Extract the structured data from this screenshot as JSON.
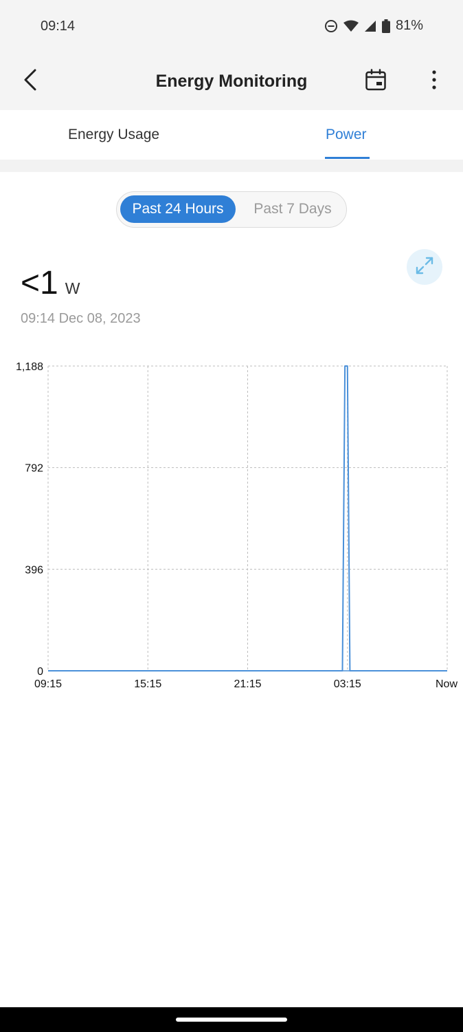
{
  "status_bar": {
    "time": "09:14",
    "battery": "81%"
  },
  "app_bar": {
    "title": "Energy Monitoring"
  },
  "tabs": [
    {
      "label": "Energy Usage",
      "active": false
    },
    {
      "label": "Power",
      "active": true
    }
  ],
  "range_selector": {
    "options": [
      "Past 24 Hours",
      "Past 7 Days"
    ],
    "selected": "Past 24 Hours"
  },
  "reading": {
    "value": "<1",
    "unit": "W",
    "timestamp": "09:14  Dec 08, 2023"
  },
  "colors": {
    "accent": "#2f7fd6",
    "line": "#4a90d9",
    "grid": "#bdbdbd"
  },
  "icons": [
    "back-arrow",
    "calendar",
    "more-vertical",
    "expand"
  ],
  "chart_data": {
    "type": "line",
    "x_ticks": [
      "09:15",
      "15:15",
      "21:15",
      "03:15",
      "Now"
    ],
    "y_ticks": [
      "1,188",
      "792",
      "396",
      "0"
    ],
    "ylim": [
      0,
      1188
    ],
    "grid": true,
    "series": [
      {
        "x": [
          0,
          17.7,
          17.85,
          18.0,
          18.15,
          24
        ],
        "y": [
          0,
          0,
          1188,
          1188,
          0,
          0
        ]
      }
    ]
  }
}
